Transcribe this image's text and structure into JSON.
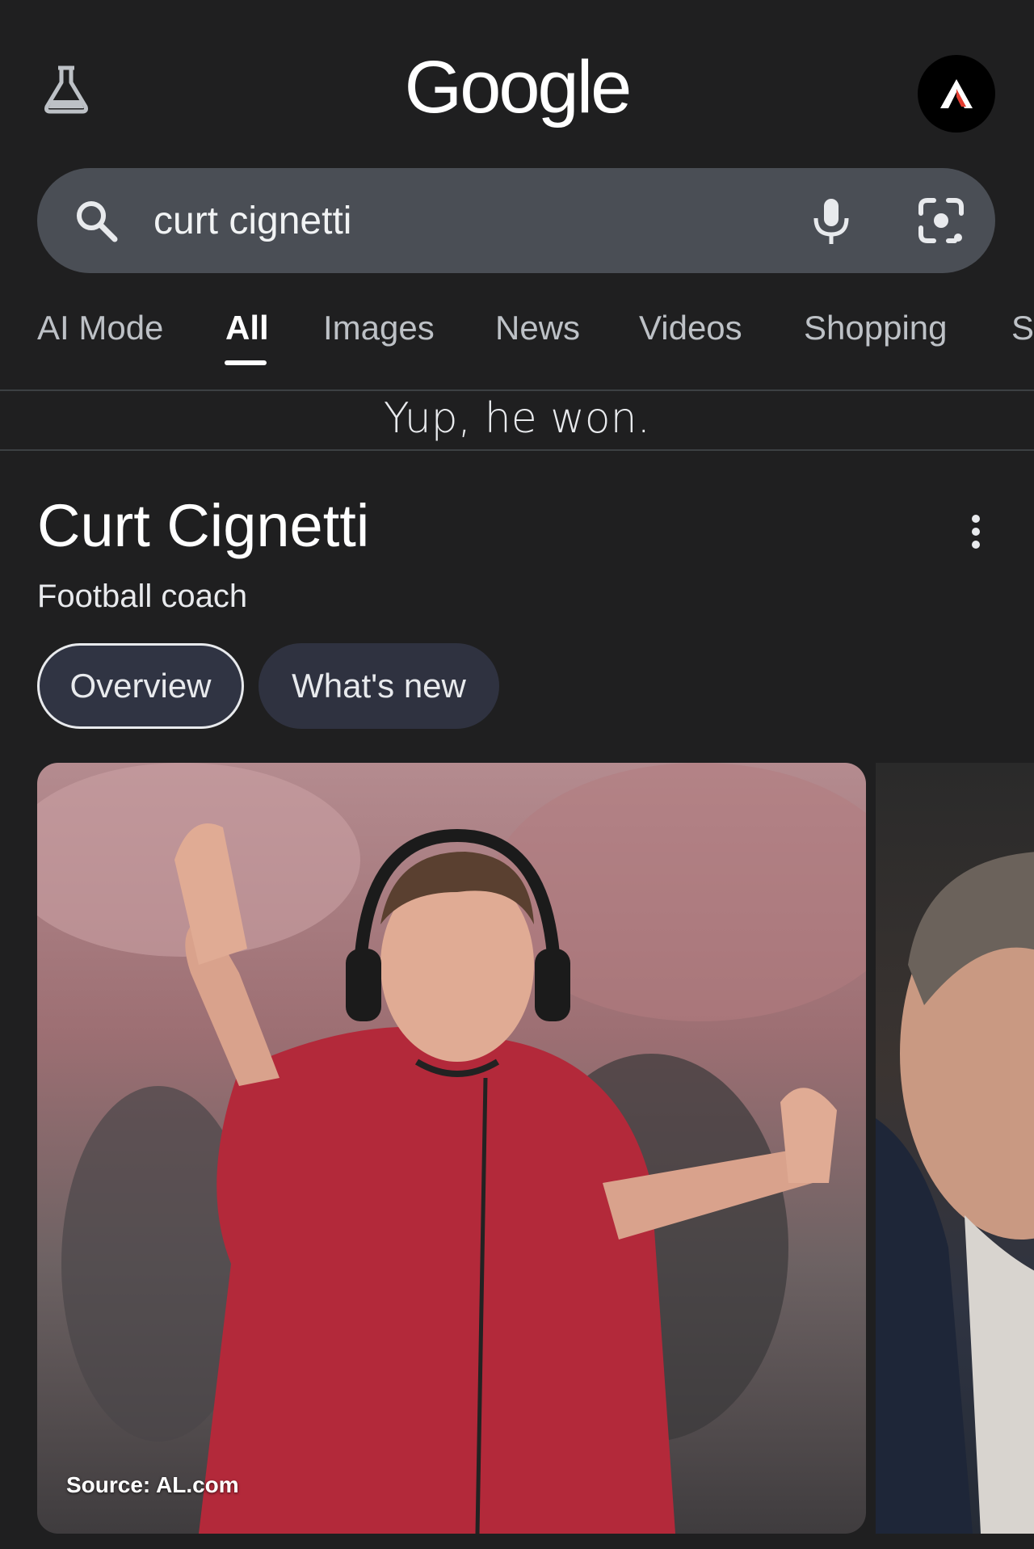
{
  "header": {
    "logo_text": "Google",
    "labs_icon": "flask-icon",
    "avatar_icon": "account-avatar"
  },
  "search": {
    "query": "curt cignetti",
    "search_icon": "search-icon",
    "mic_icon": "microphone-icon",
    "lens_icon": "google-lens-icon"
  },
  "tabs": [
    {
      "label": "AI Mode",
      "active": false
    },
    {
      "label": "All",
      "active": true
    },
    {
      "label": "Images",
      "active": false
    },
    {
      "label": "News",
      "active": false
    },
    {
      "label": "Videos",
      "active": false
    },
    {
      "label": "Shopping",
      "active": false
    },
    {
      "label": "S",
      "active": false
    }
  ],
  "caption": "Yup, he won.",
  "knowledge_panel": {
    "title": "Curt Cignetti",
    "subtitle": "Football coach",
    "chips": [
      "Overview",
      "What's new"
    ],
    "image_source": "Source: AL.com"
  },
  "colors": {
    "background": "#1f1f20",
    "searchbar": "#4a4e55",
    "chip_active_bg": "#303443",
    "chip_bg": "#2f3240"
  }
}
